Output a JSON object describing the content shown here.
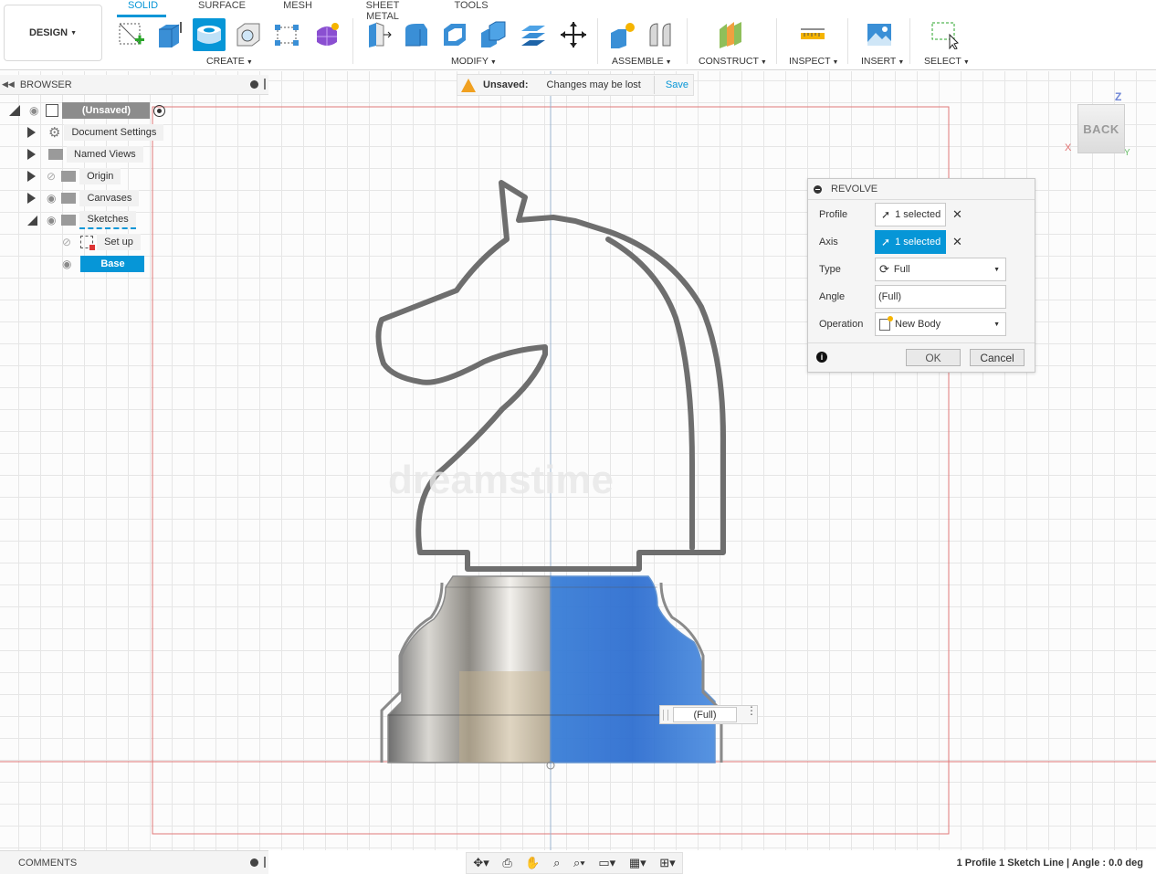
{
  "toolbar": {
    "workspace_button": "DESIGN",
    "tabs": [
      "SOLID",
      "SURFACE",
      "MESH",
      "SHEET METAL",
      "TOOLS"
    ],
    "groups": [
      "CREATE",
      "MODIFY",
      "ASSEMBLE",
      "CONSTRUCT",
      "INSPECT",
      "INSERT",
      "SELECT"
    ],
    "accent_color": "#0696d7"
  },
  "browser": {
    "title": "BROWSER",
    "root": "(Unsaved)",
    "items": [
      {
        "label": "Document Settings",
        "icon": "gear-icon"
      },
      {
        "label": "Named Views",
        "icon": "folder-icon"
      },
      {
        "label": "Origin",
        "icon": "folder-icon"
      },
      {
        "label": "Canvases",
        "icon": "folder-icon"
      },
      {
        "label": "Sketches",
        "icon": "folder-icon"
      },
      {
        "label": "Set up",
        "icon": "sketch-icon"
      },
      {
        "label": "Base",
        "icon": "sketch-icon"
      }
    ]
  },
  "banner": {
    "title": "Unsaved:",
    "message": "Changes may be lost",
    "action": "Save"
  },
  "revolve": {
    "title": "REVOLVE",
    "profile_label": "Profile",
    "profile_value": "1 selected",
    "axis_label": "Axis",
    "axis_value": "1 selected",
    "type_label": "Type",
    "type_value": "Full",
    "angle_label": "Angle",
    "angle_value": "(Full)",
    "operation_label": "Operation",
    "operation_value": "New Body",
    "ok": "OK",
    "cancel": "Cancel"
  },
  "viewport": {
    "viewcube_face": "BACK",
    "axis_z": "Z",
    "axis_x": "X",
    "axis_y": "Y",
    "value_popup": "(Full)",
    "watermark": "dreamstime"
  },
  "bottom": {
    "comments": "COMMENTS",
    "status": "1 Profile 1 Sketch Line | Angle : 0.0 deg"
  }
}
